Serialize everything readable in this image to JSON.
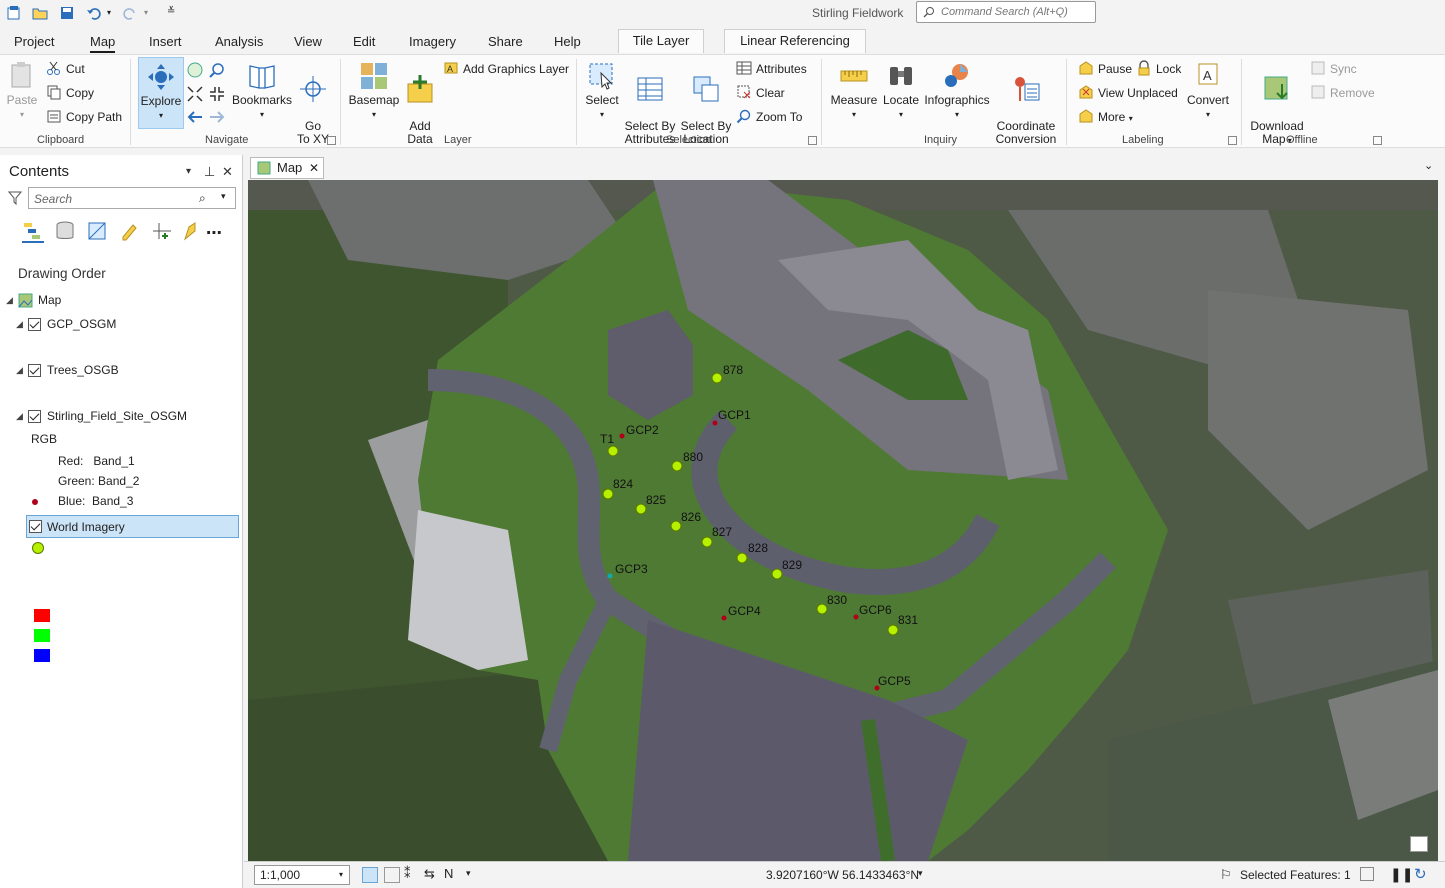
{
  "app": {
    "title": "Stirling Fieldwork",
    "command_search_placeholder": "Command Search (Alt+Q)"
  },
  "tabs": [
    "Project",
    "Map",
    "Insert",
    "Analysis",
    "View",
    "Edit",
    "Imagery",
    "Share",
    "Help"
  ],
  "active_tab": "Map",
  "context_tabs": [
    "Tile Layer",
    "Linear Referencing"
  ],
  "ribbon": {
    "clipboard": {
      "label": "Clipboard",
      "paste": "Paste",
      "cut": "Cut",
      "copy": "Copy",
      "copy_path": "Copy Path"
    },
    "navigate": {
      "label": "Navigate",
      "explore": "Explore",
      "bookmarks": "Bookmarks",
      "go_to_xy": "Go\nTo XY"
    },
    "layer": {
      "label": "Layer",
      "basemap": "Basemap",
      "add_data": "Add\nData",
      "add_graphics_layer": "Add Graphics Layer"
    },
    "selection": {
      "label": "Selection",
      "select": "Select",
      "select_by_attributes": "Select By\nAttributes",
      "select_by_location": "Select By\nLocation",
      "attributes": "Attributes",
      "clear": "Clear",
      "zoom_to": "Zoom To"
    },
    "inquiry": {
      "label": "Inquiry",
      "measure": "Measure",
      "locate": "Locate",
      "infographics": "Infographics",
      "coordinate_conversion": "Coordinate\nConversion"
    },
    "labeling": {
      "label": "Labeling",
      "pause": "Pause",
      "lock": "Lock",
      "view_unplaced": "View Unplaced",
      "more": "More",
      "convert": "Convert"
    },
    "offline": {
      "label": "Offline",
      "download_map": "Download\nMap",
      "sync": "Sync",
      "remove": "Remove"
    }
  },
  "contents": {
    "title": "Contents",
    "search_placeholder": "Search",
    "drawing_order": "Drawing Order",
    "map_label": "Map",
    "layers": {
      "gcp": "GCP_OSGM",
      "trees": "Trees_OSGB",
      "site": "Stirling_Field_Site_OSGM",
      "rgb": "RGB",
      "red": "Red:   Band_1",
      "green": "Green: Band_2",
      "blue": "Blue:  Band_3",
      "world": "World Imagery"
    }
  },
  "map_tab": "Map",
  "map_labels": {
    "gcps": [
      "GCP1",
      "GCP2",
      "GCP3",
      "GCP4",
      "GCP5",
      "GCP6"
    ],
    "trees": [
      "878",
      "T1",
      "880",
      "824",
      "825",
      "826",
      "827",
      "828",
      "829",
      "830",
      "831"
    ]
  },
  "status": {
    "scale": "1:1,000",
    "coords": "3.9207160°W 56.1433463°N",
    "selected": "Selected Features: 1"
  },
  "colors": {
    "accent": "#cce4f7",
    "gcp": "#c0001a",
    "tree": "#b6f000",
    "red": "#ff0000",
    "green": "#00ff00",
    "blue": "#0000ff"
  }
}
